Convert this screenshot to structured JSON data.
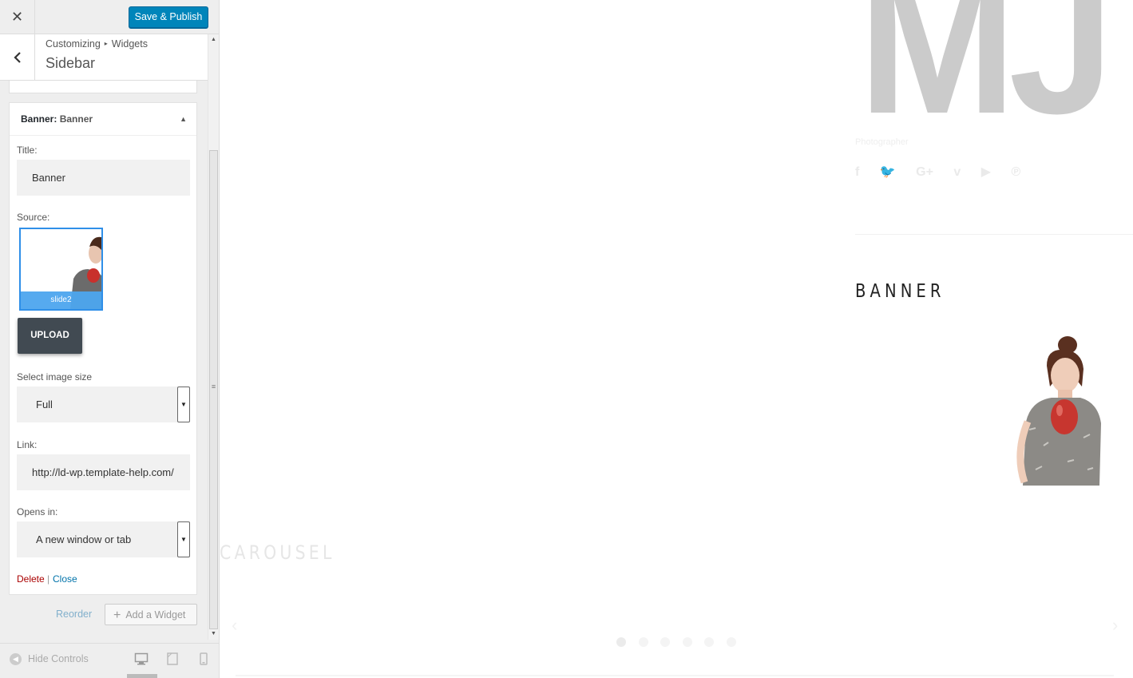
{
  "topbar": {
    "close_symbol": "✕",
    "save_label": "Save & Publish"
  },
  "section": {
    "back_symbol": "‹",
    "crumb_root": "Customizing",
    "crumb_sep": "▸",
    "crumb_current": "Widgets",
    "title": "Sidebar"
  },
  "widget": {
    "header_type": "Banner:",
    "header_name": "Banner",
    "toggle_symbol": "▲",
    "title_label": "Title:",
    "title_value": "Banner",
    "source_label": "Source:",
    "image_caption": "slide2",
    "upload_label": "UPLOAD",
    "size_label": "Select image size",
    "size_value": "Full",
    "link_label": "Link:",
    "link_value": "http://ld-wp.template-help.com/",
    "opens_label": "Opens in:",
    "opens_value": "A new window or tab",
    "delete_label": "Delete",
    "separator": "|",
    "close_label": "Close"
  },
  "actions": {
    "reorder_label": "Reorder",
    "add_widget_label": "Add a Widget",
    "add_symbol": "+"
  },
  "footer": {
    "hide_controls_label": "Hide Controls",
    "active_device": "desktop"
  },
  "scrollbar": {
    "up": "▲",
    "down": "▼",
    "grip": "≡"
  },
  "preview": {
    "logo_text": "MJ",
    "tagline": "Photographer",
    "social_icons": [
      "facebook-icon",
      "twitter-icon",
      "google-plus-icon",
      "vimeo-icon",
      "youtube-icon",
      "pinterest-icon"
    ],
    "social_glyphs": [
      "f",
      "🐦",
      "G+",
      "v",
      "▶",
      "℗"
    ],
    "banner_title": "BANNER",
    "carousel_title": "CAROUSEL",
    "carousel_prev": "‹",
    "carousel_next": "›",
    "carousel_dots": 6,
    "carousel_active_dot": 1
  },
  "colors": {
    "primary": "#0085ba",
    "upload_bg": "#414a52",
    "delete": "#a00000",
    "link": "#0073aa"
  }
}
